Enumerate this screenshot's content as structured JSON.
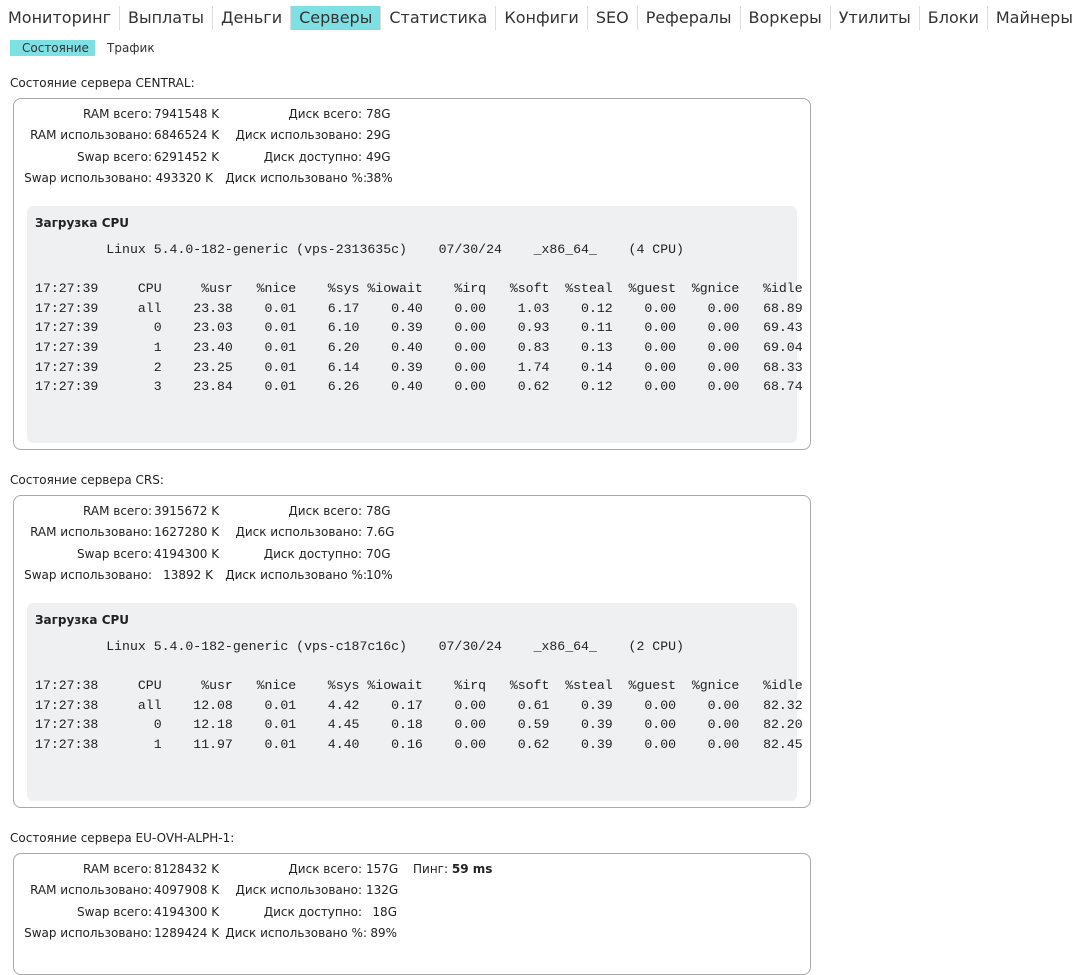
{
  "nav": {
    "tabs": [
      {
        "label": "Мониторинг"
      },
      {
        "label": "Выплаты"
      },
      {
        "label": "Деньги"
      },
      {
        "label": "Серверы",
        "active": true
      },
      {
        "label": "Статистика"
      },
      {
        "label": "Конфиги"
      },
      {
        "label": "SEO"
      },
      {
        "label": "Рефералы"
      },
      {
        "label": "Воркеры"
      },
      {
        "label": "Утилиты"
      },
      {
        "label": "Блоки"
      },
      {
        "label": "Майнеры"
      }
    ],
    "subtabs": [
      {
        "label": "Состояние",
        "active": true
      },
      {
        "label": "Трафик"
      }
    ],
    "accent_color": "#7fe0e4"
  },
  "labels": {
    "ram_total": "RAM всего:",
    "ram_used": "RAM использовано:",
    "swap_total": "Swap всего:",
    "swap_used": "Swap использовано:",
    "disk_total": "Диск всего:",
    "disk_used": "Диск использовано:",
    "disk_free": "Диск доступно:",
    "disk_used_pct": "Диск использовано %:",
    "cpu_load": "Загрузка CPU",
    "ping": "Пинг:"
  },
  "servers": [
    {
      "title": "Состояние сервера CENTRAL:",
      "ram_total": "7941548 K",
      "ram_used": "6846524 K",
      "swap_total": "6291452 K",
      "swap_used": "493320 K",
      "disk_total": "78G",
      "disk_used": "29G",
      "disk_free": "49G",
      "disk_used_pct": "38%",
      "cpu_output": "         Linux 5.4.0-182-generic (vps-2313635c)    07/30/24    _x86_64_    (4 CPU)\n\n17:27:39     CPU     %usr   %nice    %sys %iowait    %irq   %soft  %steal  %guest  %gnice   %idle\n17:27:39     all    23.38    0.01    6.17    0.40    0.00    1.03    0.12    0.00    0.00   68.89\n17:27:39       0    23.03    0.01    6.10    0.39    0.00    0.93    0.11    0.00    0.00   69.43\n17:27:39       1    23.40    0.01    6.20    0.40    0.00    0.83    0.13    0.00    0.00   69.04\n17:27:39       2    23.25    0.01    6.14    0.39    0.00    1.74    0.14    0.00    0.00   68.33\n17:27:39       3    23.84    0.01    6.26    0.40    0.00    0.62    0.12    0.00    0.00   68.74"
    },
    {
      "title": "Состояние сервера CRS:",
      "ram_total": "3915672 K",
      "ram_used": "1627280 K",
      "swap_total": "4194300 K",
      "swap_used": "13892 K",
      "disk_total": "78G",
      "disk_used": "7.6G",
      "disk_free": "70G",
      "disk_used_pct": "10%",
      "cpu_output": "         Linux 5.4.0-182-generic (vps-c187c16c)    07/30/24    _x86_64_    (2 CPU)\n\n17:27:38     CPU     %usr   %nice    %sys %iowait    %irq   %soft  %steal  %guest  %gnice   %idle\n17:27:38     all    12.08    0.01    4.42    0.17    0.00    0.61    0.39    0.00    0.00   82.32\n17:27:38       0    12.18    0.01    4.45    0.18    0.00    0.59    0.39    0.00    0.00   82.20\n17:27:38       1    11.97    0.01    4.40    0.16    0.00    0.62    0.39    0.00    0.00   82.45"
    },
    {
      "title": "Состояние сервера EU-OVH-ALPH-1:",
      "ram_total": "8128432 K",
      "ram_used": "4097908 K",
      "swap_total": "4194300 K",
      "swap_used": "1289424 K",
      "disk_total": "157G",
      "disk_used": "132G",
      "disk_free": "18G",
      "disk_used_pct": "89%",
      "ping": "59 ms"
    }
  ]
}
